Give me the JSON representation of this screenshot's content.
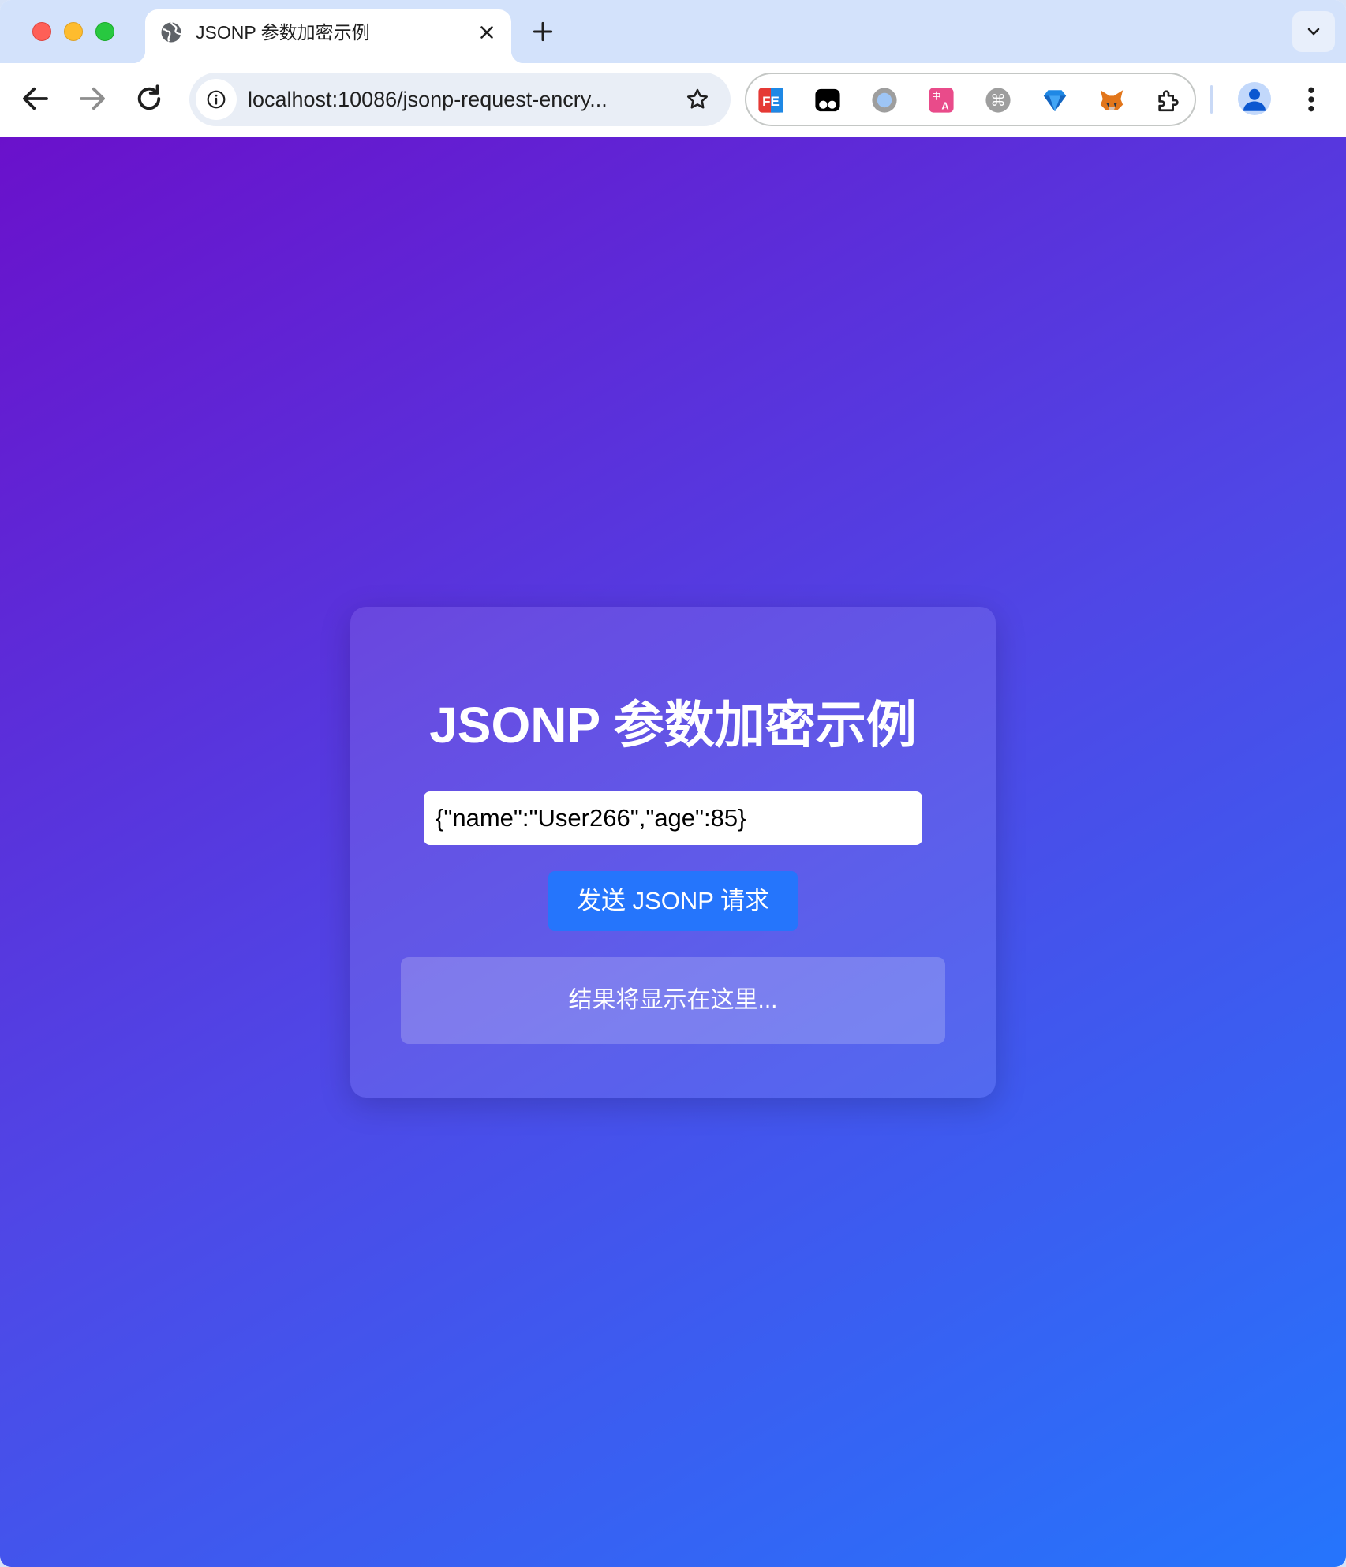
{
  "browser": {
    "tab": {
      "title": "JSONP 参数加密示例"
    },
    "address_bar": {
      "url": "localhost:10086/jsonp-request-encry..."
    },
    "extensions": [
      "fe-helper-icon",
      "tampermonkey-icon",
      "circle-extension-icon",
      "translate-icon",
      "command-icon",
      "diamond-extension-icon",
      "metamask-fox-icon",
      "puzzle-extensions-icon"
    ]
  },
  "page": {
    "title": "JSONP 参数加密示例",
    "input": {
      "value": "{\"name\":\"User266\",\"age\":85}"
    },
    "send_button_label": "发送 JSONP 请求",
    "result_text": "结果将显示在这里..."
  },
  "colors": {
    "gradient_start": "#6a11cb",
    "gradient_end": "#2575fc",
    "button": "#2575fc"
  }
}
